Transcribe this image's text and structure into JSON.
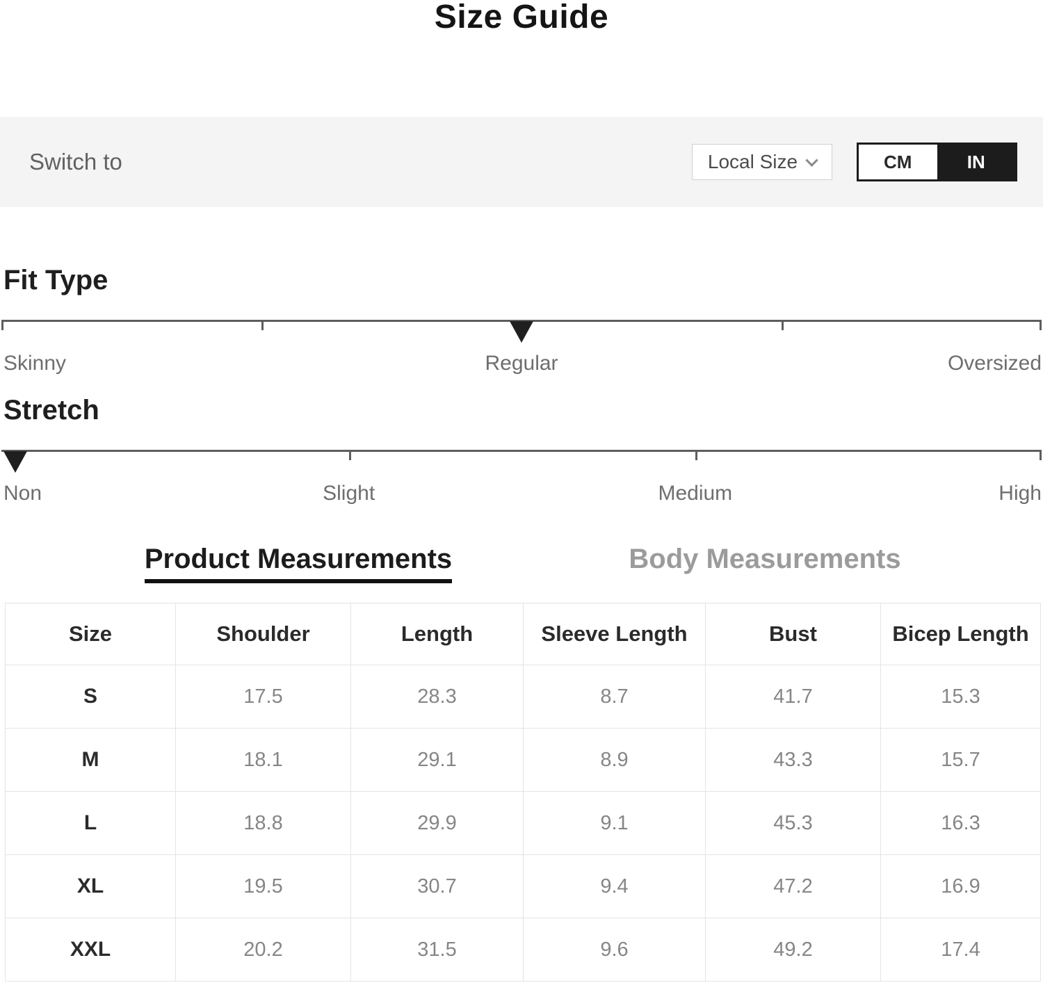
{
  "page": {
    "title": "Size Guide"
  },
  "unit_bar": {
    "switch_label": "Switch to",
    "local_size_label": "Local Size",
    "units": {
      "cm": "CM",
      "in": "IN",
      "selected": "IN"
    }
  },
  "fit_type": {
    "heading": "Fit Type",
    "options": [
      "Skinny",
      "Regular",
      "Oversized"
    ],
    "selected": "Regular",
    "marker_position_pct": 50,
    "ticks_pct": [
      0,
      25,
      50,
      75,
      100
    ]
  },
  "stretch": {
    "heading": "Stretch",
    "options": [
      "Non",
      "Slight",
      "Medium",
      "High"
    ],
    "selected": "Non",
    "marker_position_pct": 0,
    "ticks_pct": [
      0,
      33.4,
      66.7,
      100
    ]
  },
  "tabs": {
    "product": {
      "label": "Product Measurements",
      "active": true
    },
    "body": {
      "label": "Body Measurements",
      "active": false
    }
  },
  "table": {
    "headers": [
      "Size",
      "Shoulder",
      "Length",
      "Sleeve Length",
      "Bust",
      "Bicep Length"
    ],
    "rows": [
      {
        "size": "S",
        "values": [
          "17.5",
          "28.3",
          "8.7",
          "41.7",
          "15.3"
        ]
      },
      {
        "size": "M",
        "values": [
          "18.1",
          "29.1",
          "8.9",
          "43.3",
          "15.7"
        ]
      },
      {
        "size": "L",
        "values": [
          "18.8",
          "29.9",
          "9.1",
          "45.3",
          "16.3"
        ]
      },
      {
        "size": "XL",
        "values": [
          "19.5",
          "30.7",
          "9.4",
          "47.2",
          "16.9"
        ]
      },
      {
        "size": "XXL",
        "values": [
          "20.2",
          "31.5",
          "9.6",
          "49.2",
          "17.4"
        ]
      }
    ]
  },
  "colors": {
    "accent": "#1c1c1c",
    "bar_background": "#f4f4f4",
    "muted_text": "#868686",
    "border": "#e4e4e4"
  }
}
